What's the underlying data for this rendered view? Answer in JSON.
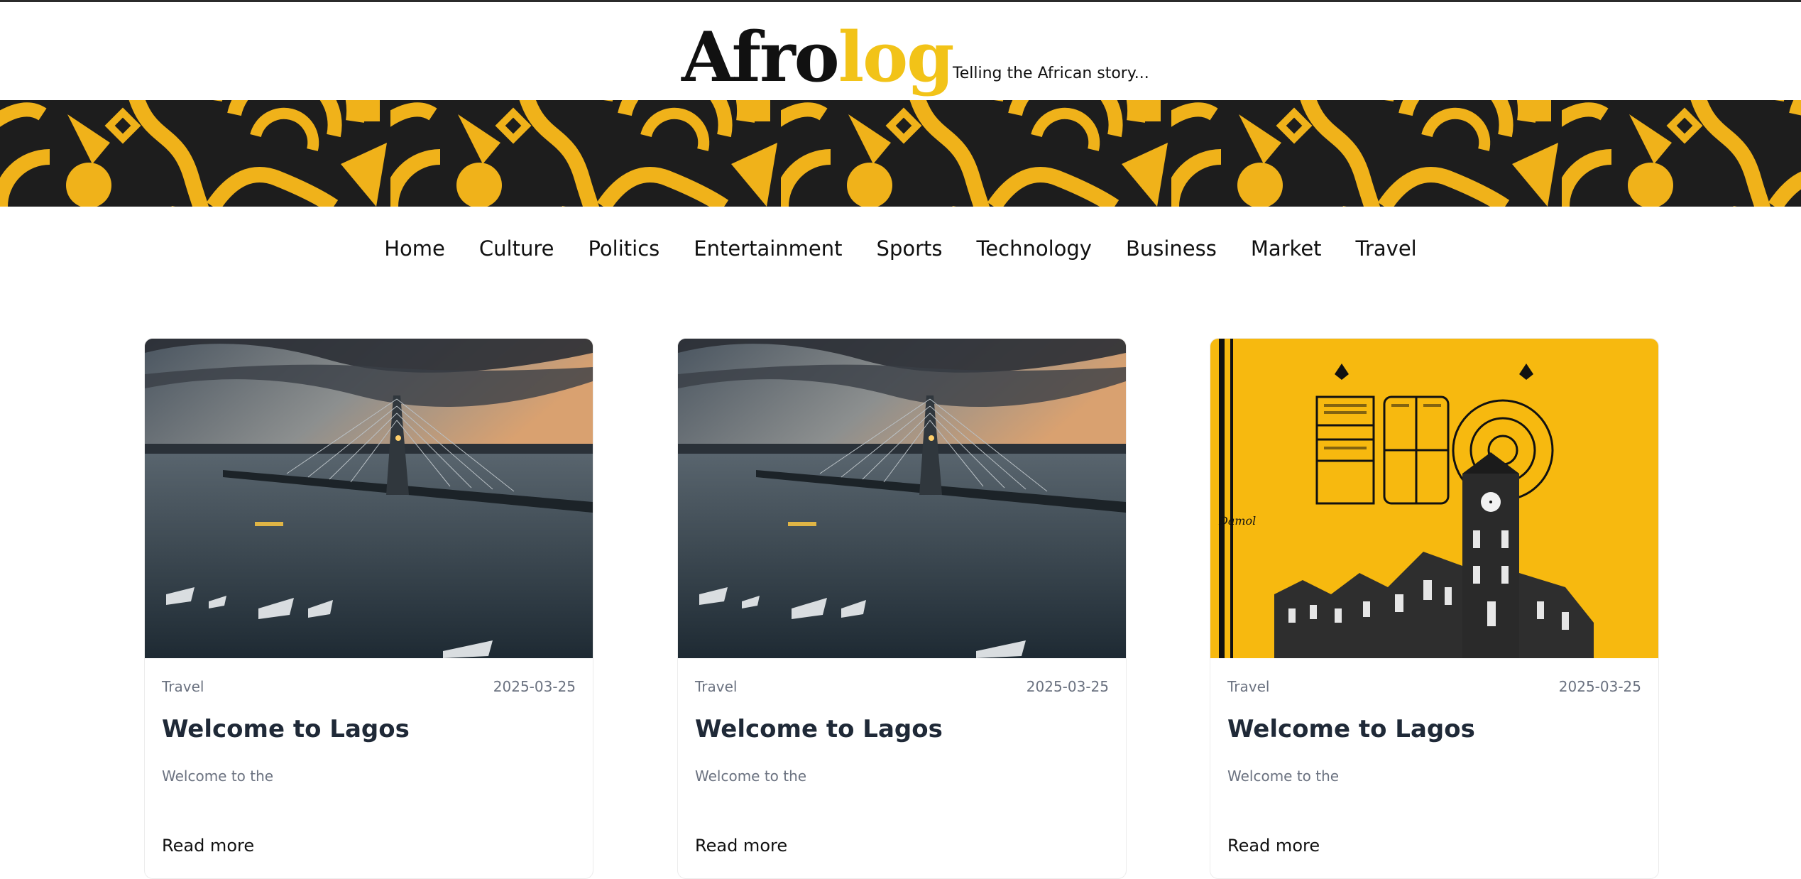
{
  "header": {
    "logo_part1": "Afro",
    "logo_part2": "log",
    "tagline": "Telling the African story...",
    "colors": {
      "yellow": "#f2c318",
      "dark": "#1d1d1d"
    }
  },
  "nav": {
    "items": [
      "Home",
      "Culture",
      "Politics",
      "Entertainment",
      "Sports",
      "Technology",
      "Business",
      "Market",
      "Travel"
    ]
  },
  "cards": [
    {
      "category": "Travel",
      "date": "2025-03-25",
      "title": "Welcome to Lagos",
      "excerpt": "Welcome to the",
      "read": "Read more",
      "image": "lekki-bridge-photo"
    },
    {
      "category": "Travel",
      "date": "2025-03-25",
      "title": "Welcome to Lagos",
      "excerpt": "Welcome to the",
      "read": "Read more",
      "image": "lekki-bridge-photo"
    },
    {
      "category": "Travel",
      "date": "2025-03-25",
      "title": "Welcome to Lagos",
      "excerpt": "Welcome to the",
      "read": "Read more",
      "image": "eko-illustration",
      "image_text": "Damol"
    }
  ]
}
